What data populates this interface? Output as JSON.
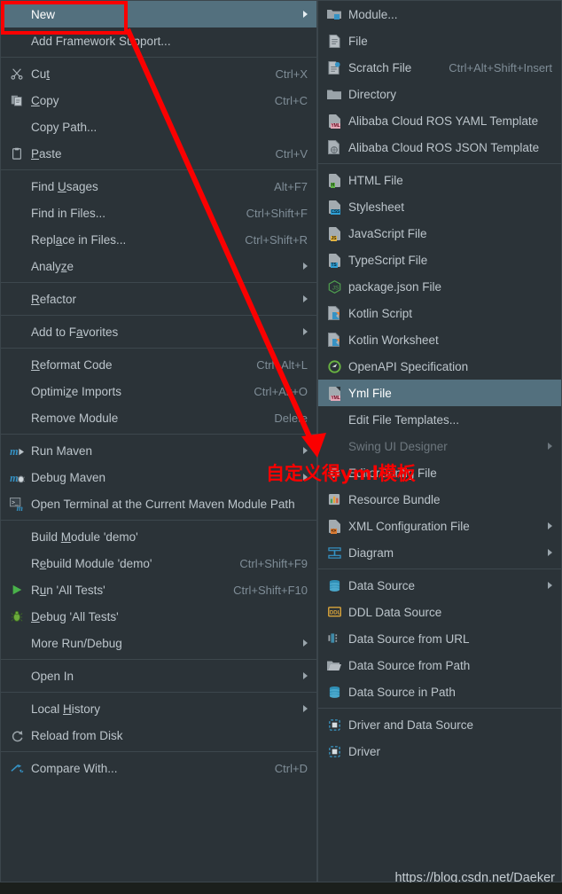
{
  "theme": {
    "menu_background": "#2b3338",
    "menu_border": "#3c464c",
    "selection": "#53707e",
    "text": "#bcc5cb",
    "shortcut_text": "#7f8d97",
    "disabled_text": "#6d777e",
    "annotation_red": "#fb0000"
  },
  "context_menu": {
    "name": "project-context-menu",
    "items": [
      {
        "label": "New",
        "icon": "none",
        "shortcut": "",
        "submenu": true,
        "selected": true
      },
      {
        "label": "Add Framework Support...",
        "icon": "none",
        "shortcut": "",
        "submenu": false
      },
      {
        "separator": true
      },
      {
        "label": "Cut",
        "mnemonic": "t",
        "icon": "scissors-icon",
        "shortcut": "Ctrl+X",
        "submenu": false
      },
      {
        "label": "Copy",
        "mnemonic": "C",
        "icon": "copy-icon",
        "shortcut": "Ctrl+C",
        "submenu": false
      },
      {
        "label": "Copy Path...",
        "icon": "none",
        "shortcut": "",
        "submenu": false
      },
      {
        "label": "Paste",
        "mnemonic": "P",
        "icon": "clipboard-icon",
        "shortcut": "Ctrl+V",
        "submenu": false
      },
      {
        "separator": true
      },
      {
        "label": "Find Usages",
        "mnemonic": "U",
        "icon": "none",
        "shortcut": "Alt+F7",
        "submenu": false
      },
      {
        "label": "Find in Files...",
        "icon": "none",
        "shortcut": "Ctrl+Shift+F",
        "submenu": false
      },
      {
        "label": "Replace in Files...",
        "mnemonic": "a",
        "icon": "none",
        "shortcut": "Ctrl+Shift+R",
        "submenu": false
      },
      {
        "label": "Analyze",
        "mnemonic": "z",
        "icon": "none",
        "shortcut": "",
        "submenu": true
      },
      {
        "separator": true
      },
      {
        "label": "Refactor",
        "mnemonic": "R",
        "icon": "none",
        "shortcut": "",
        "submenu": true
      },
      {
        "separator": true
      },
      {
        "label": "Add to Favorites",
        "mnemonic": "a",
        "icon": "none",
        "shortcut": "",
        "submenu": true
      },
      {
        "separator": true
      },
      {
        "label": "Reformat Code",
        "mnemonic": "R",
        "icon": "none",
        "shortcut": "Ctrl+Alt+L",
        "submenu": false
      },
      {
        "label": "Optimize Imports",
        "mnemonic": "z",
        "icon": "none",
        "shortcut": "Ctrl+Alt+O",
        "submenu": false
      },
      {
        "label": "Remove Module",
        "icon": "none",
        "shortcut": "Delete",
        "submenu": false
      },
      {
        "separator": true
      },
      {
        "label": "Run Maven",
        "icon": "maven-run-icon",
        "shortcut": "",
        "submenu": true
      },
      {
        "label": "Debug Maven",
        "icon": "maven-debug-icon",
        "shortcut": "",
        "submenu": true
      },
      {
        "label": "Open Terminal at the Current Maven Module Path",
        "icon": "terminal-maven-icon",
        "shortcut": "",
        "submenu": false
      },
      {
        "separator": true
      },
      {
        "label": "Build Module 'demo'",
        "mnemonic": "M",
        "icon": "none",
        "shortcut": "",
        "submenu": false
      },
      {
        "label": "Rebuild Module 'demo'",
        "mnemonic": "e",
        "icon": "none",
        "shortcut": "Ctrl+Shift+F9",
        "submenu": false
      },
      {
        "label": "Run 'All Tests'",
        "mnemonic": "u",
        "icon": "run-green-triangle-icon",
        "shortcut": "Ctrl+Shift+F10",
        "submenu": false
      },
      {
        "label": "Debug 'All Tests'",
        "mnemonic": "D",
        "icon": "debug-bug-icon",
        "shortcut": "",
        "submenu": false
      },
      {
        "label": "More Run/Debug",
        "icon": "none",
        "shortcut": "",
        "submenu": true
      },
      {
        "separator": true
      },
      {
        "label": "Open In",
        "icon": "none",
        "shortcut": "",
        "submenu": true
      },
      {
        "separator": true
      },
      {
        "label": "Local History",
        "mnemonic": "H",
        "icon": "none",
        "shortcut": "",
        "submenu": true
      },
      {
        "label": "Reload from Disk",
        "icon": "reload-icon",
        "shortcut": "",
        "submenu": false
      },
      {
        "separator": true
      },
      {
        "label": "Compare With...",
        "icon": "compare-icon",
        "shortcut": "Ctrl+D",
        "submenu": false
      }
    ]
  },
  "submenu": {
    "name": "new-submenu",
    "items": [
      {
        "label": "Module...",
        "icon": "module-folder-icon",
        "shortcut": "",
        "submenu": false
      },
      {
        "label": "File",
        "icon": "file-icon",
        "shortcut": "",
        "submenu": false
      },
      {
        "label": "Scratch File",
        "icon": "scratch-file-icon",
        "shortcut": "Ctrl+Alt+Shift+Insert",
        "submenu": false
      },
      {
        "label": "Directory",
        "icon": "directory-folder-icon",
        "shortcut": "",
        "submenu": false
      },
      {
        "label": "Alibaba Cloud ROS YAML Template",
        "icon": "yaml-file-icon",
        "shortcut": "",
        "submenu": false
      },
      {
        "label": "Alibaba Cloud ROS JSON Template",
        "icon": "json-file-icon",
        "shortcut": "",
        "submenu": false
      },
      {
        "separator": true
      },
      {
        "label": "HTML File",
        "icon": "html-file-icon",
        "shortcut": "",
        "submenu": false
      },
      {
        "label": "Stylesheet",
        "icon": "css-file-icon",
        "shortcut": "",
        "submenu": false
      },
      {
        "label": "JavaScript File",
        "icon": "js-file-icon",
        "shortcut": "",
        "submenu": false
      },
      {
        "label": "TypeScript File",
        "icon": "ts-file-icon",
        "shortcut": "",
        "submenu": false
      },
      {
        "label": "package.json File",
        "icon": "nodejs-icon",
        "shortcut": "",
        "submenu": false
      },
      {
        "label": "Kotlin Script",
        "icon": "kotlin-script-icon",
        "shortcut": "",
        "submenu": false
      },
      {
        "label": "Kotlin Worksheet",
        "icon": "kotlin-worksheet-icon",
        "shortcut": "",
        "submenu": false
      },
      {
        "label": "OpenAPI Specification",
        "icon": "openapi-icon",
        "shortcut": "",
        "submenu": false
      },
      {
        "label": "Yml File",
        "icon": "yml-file-icon",
        "shortcut": "",
        "submenu": false,
        "selected": true
      },
      {
        "label": "Edit File Templates...",
        "icon": "none",
        "shortcut": "",
        "submenu": false
      },
      {
        "label": "Swing UI Designer",
        "icon": "none",
        "shortcut": "",
        "submenu": true,
        "disabled": true
      },
      {
        "label": "EditorConfig File",
        "icon": "editorconfig-gear-icon",
        "shortcut": "",
        "submenu": false
      },
      {
        "label": "Resource Bundle",
        "icon": "resource-bundle-icon",
        "shortcut": "",
        "submenu": false
      },
      {
        "label": "XML Configuration File",
        "icon": "xml-file-icon",
        "shortcut": "",
        "submenu": true
      },
      {
        "label": "Diagram",
        "icon": "diagram-icon",
        "shortcut": "",
        "submenu": true
      },
      {
        "separator": true
      },
      {
        "label": "Data Source",
        "icon": "database-icon",
        "shortcut": "",
        "submenu": true
      },
      {
        "label": "DDL Data Source",
        "icon": "ddl-icon",
        "shortcut": "",
        "submenu": false
      },
      {
        "label": "Data Source from URL",
        "icon": "datasource-url-icon",
        "shortcut": "",
        "submenu": false
      },
      {
        "label": "Data Source from Path",
        "icon": "open-folder-icon",
        "shortcut": "",
        "submenu": false
      },
      {
        "label": "Data Source in Path",
        "icon": "database-icon",
        "shortcut": "",
        "submenu": false
      },
      {
        "separator": true
      },
      {
        "label": "Driver and Data Source",
        "icon": "driver-icon",
        "shortcut": "",
        "submenu": false
      },
      {
        "label": "Driver",
        "icon": "driver-icon",
        "shortcut": "",
        "submenu": false
      }
    ]
  },
  "annotations": {
    "chinese_note": "自定义得yml模板",
    "highlight_box_target": "New",
    "arrow_from": "New",
    "arrow_to": "Yml File"
  },
  "watermark": "https://blog.csdn.net/Daeker"
}
